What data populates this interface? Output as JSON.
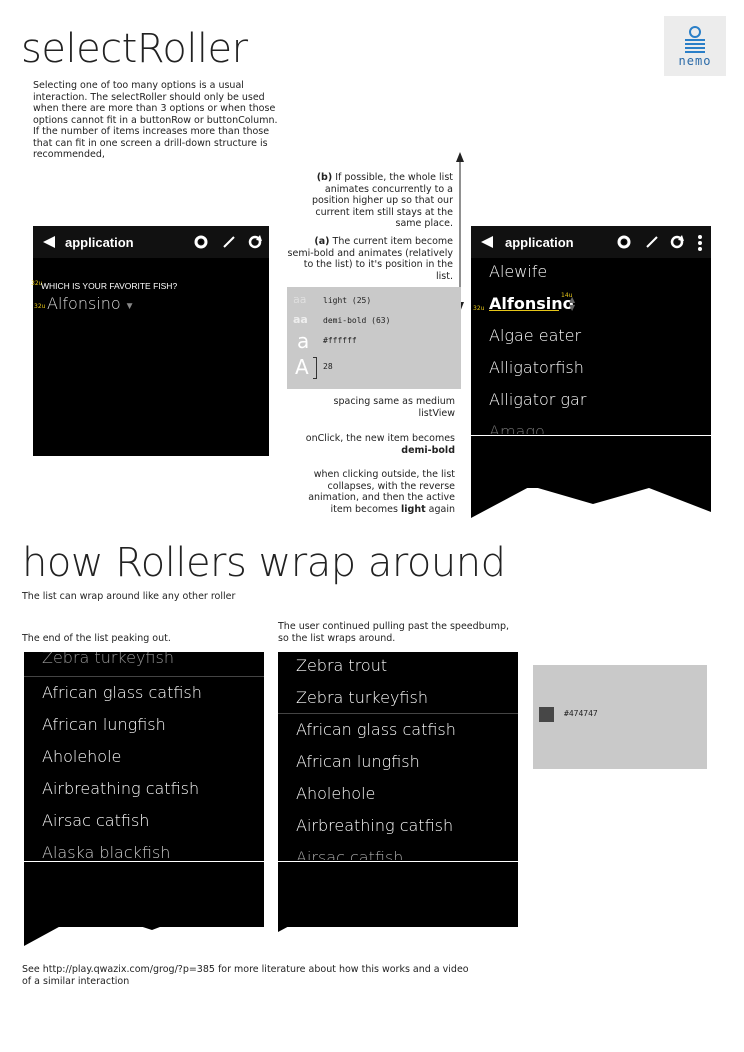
{
  "title1": "selectRoller",
  "intro": "Selecting one of too many options is a usual interaction. The selectRoller should only be used when there are more than 3 options or when those options cannot fit in a buttonRow or buttonColumn. If the  number of items increases more than those that can fit in one screen a drill-down structure is recommended,",
  "logo_text": "nemo",
  "left_phone": {
    "app_title": "application",
    "question": "WHICH IS YOUR FAVORITE FISH?",
    "selected": "Alfonsino",
    "label_a": "32u",
    "label_b": "32u"
  },
  "notes": {
    "b_label": "(b)",
    "b_text": "If possible, the whole list animates concurrently to a position higher up so that our current item still stays at the same place.",
    "a_label": "(a)",
    "a_text": "The current item become semi-bold and animates (relatively to the list) to it's position in the list.",
    "spacing": "spacing same as medium listView",
    "onclick_text": "onClick, the new item becomes",
    "onclick_bold": "demi-bold",
    "outside_text": "when clicking outside, the list collapses, with the reverse animation, and then the active item becomes",
    "outside_bold": "light",
    "outside_end": "again"
  },
  "spec": {
    "sample": "aa",
    "light": "light (25)",
    "demibold": "demi-bold (63)",
    "glyph": "a",
    "color_hex": "#ffffff",
    "size_glyph": "A",
    "size": "28"
  },
  "right_phone": {
    "app_title": "application",
    "items": [
      "Alewife",
      "Alfonsino",
      "Algae eater",
      "Alligatorfish",
      "Alligator gar",
      "Amago"
    ],
    "label_14u": "14u",
    "label_32u": "32u"
  },
  "title2": "how Rollers wrap around",
  "subtitle2": "The list can wrap around like any other roller",
  "caption_left": "The end of the list peaking out.",
  "caption_mid": "The user continued pulling past the speedbump, so the list wraps around.",
  "list_left": [
    "Zebra turkeyfish",
    "African glass catfish",
    "African lungfish",
    "Aholehole",
    "Airbreathing catfish",
    "Airsac catfish",
    "Alaska blackfish"
  ],
  "list_mid": [
    "Zebra trout",
    "Zebra turkeyfish",
    "African glass catfish",
    "African lungfish",
    "Aholehole",
    "Airbreathing catfish",
    "Airsac catfish"
  ],
  "swatch": {
    "hex": "#474747",
    "color": "#474747"
  },
  "footer": "See http://play.qwazix.com/grog/?p=385 for more literature about how this works and a video of a similar interaction"
}
